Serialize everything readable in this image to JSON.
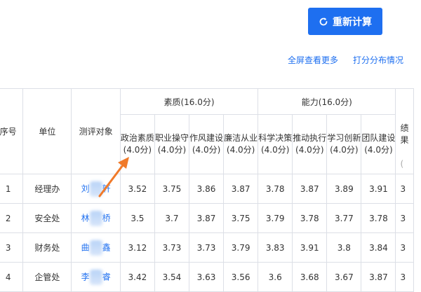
{
  "toolbar": {
    "recalc_label": "重新计算"
  },
  "links": {
    "more": "全屏查看更多",
    "distribution": "打分分布情况"
  },
  "table": {
    "headers": {
      "seq": "序号",
      "unit": "单位",
      "target": "测评对象",
      "group_quality": "素质(16.0分)",
      "group_ability": "能力(16.0分)",
      "next_partial": "绩",
      "next_partial_2": "果",
      "next_partial_3": "(",
      "sub": [
        "政治素质(4.0分)",
        "职业操守(4.0分)",
        "作风建设(4.0分)",
        "廉洁从业(4.0分)",
        "科学决策(4.0分)",
        "推动执行(4.0分)",
        "学习创新(4.0分)",
        "团队建设(4.0分)"
      ]
    },
    "rows": [
      {
        "seq": "1",
        "unit": "经理办",
        "name_first": "刘",
        "name_last": "轩",
        "scores": [
          "3.52",
          "3.75",
          "3.86",
          "3.87",
          "3.78",
          "3.87",
          "3.89",
          "3.91"
        ],
        "tail": "3"
      },
      {
        "seq": "2",
        "unit": "安全处",
        "name_first": "林",
        "name_last": "桥",
        "scores": [
          "3.5",
          "3.7",
          "3.87",
          "3.75",
          "3.79",
          "3.78",
          "3.77",
          "3.78"
        ],
        "tail": "3"
      },
      {
        "seq": "3",
        "unit": "财务处",
        "name_first": "曲",
        "name_last": "鑫",
        "scores": [
          "3.12",
          "3.73",
          "3.73",
          "3.79",
          "3.83",
          "3.91",
          "3.8",
          "3.84"
        ],
        "tail": "3"
      },
      {
        "seq": "4",
        "unit": "企管处",
        "name_first": "李",
        "name_last": "睿",
        "scores": [
          "3.42",
          "3.54",
          "3.63",
          "3.56",
          "3.6",
          "3.68",
          "3.67",
          "3.87"
        ],
        "tail": "3"
      }
    ]
  },
  "colors": {
    "accent": "#1e6ff0",
    "annotation_arrow": "#f07a2a",
    "border": "#dcdfe6"
  }
}
